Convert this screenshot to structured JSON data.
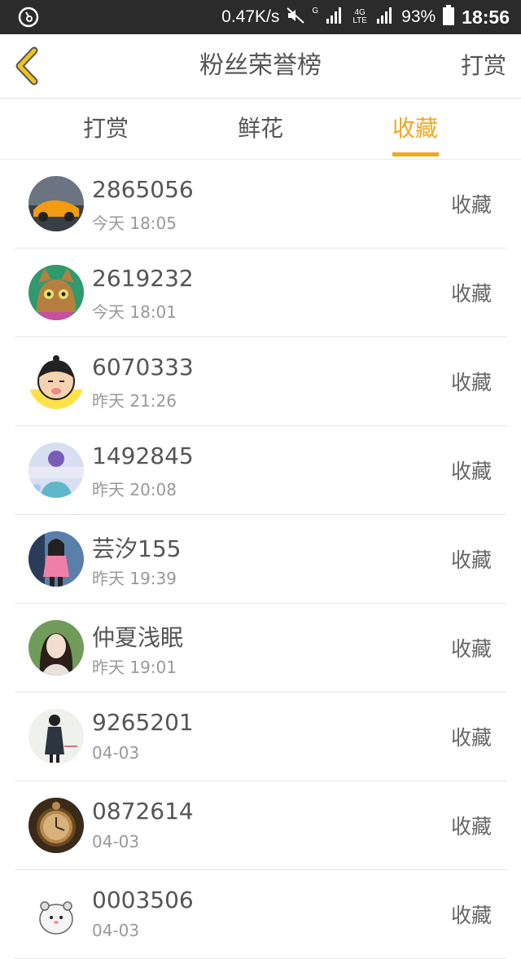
{
  "status_bar": {
    "speed": "0.47K/s",
    "network_g": "G",
    "network_lte": "4G LTE",
    "battery": "93%",
    "time": "18:56"
  },
  "header": {
    "title": "粉丝荣誉榜",
    "action": "打赏"
  },
  "tabs": [
    {
      "label": "打赏",
      "active": false
    },
    {
      "label": "鲜花",
      "active": false
    },
    {
      "label": "收藏",
      "active": true
    }
  ],
  "accent_color": "#f0a81e",
  "list": [
    {
      "name": "2865056",
      "time": "今天 18:05",
      "action": "收藏",
      "avatar": "car-avatar"
    },
    {
      "name": "2619232",
      "time": "今天 18:01",
      "action": "收藏",
      "avatar": "cat-avatar"
    },
    {
      "name": "6070333",
      "time": "昨天 21:26",
      "action": "收藏",
      "avatar": "cartoon-avatar"
    },
    {
      "name": "1492845",
      "time": "昨天 20:08",
      "action": "收藏",
      "avatar": "girl-text-avatar"
    },
    {
      "name": "芸汐155",
      "time": "昨天 19:39",
      "action": "收藏",
      "avatar": "girl-pink-avatar"
    },
    {
      "name": "仲夏浅眠",
      "time": "昨天 19:01",
      "action": "收藏",
      "avatar": "girl-portrait-avatar"
    },
    {
      "name": "9265201",
      "time": "04-03",
      "action": "收藏",
      "avatar": "girl-dress-avatar"
    },
    {
      "name": "0872614",
      "time": "04-03",
      "action": "收藏",
      "avatar": "pocket-watch-avatar"
    },
    {
      "name": "0003506",
      "time": "04-03",
      "action": "收藏",
      "avatar": "hamster-avatar"
    }
  ]
}
